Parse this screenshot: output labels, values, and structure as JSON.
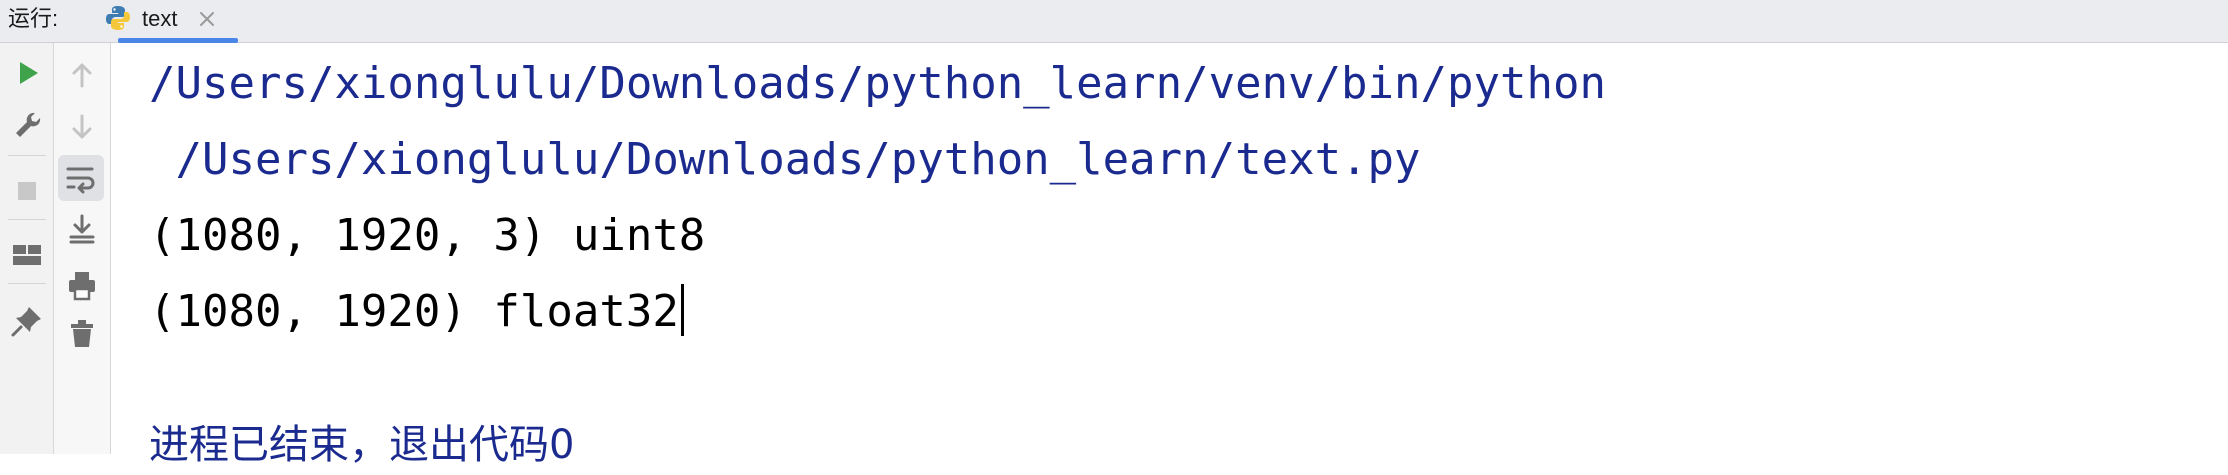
{
  "header": {
    "run_label": "运行:",
    "tab": {
      "title": "text",
      "icon": "python-icon"
    }
  },
  "toolbar": {
    "primary": [
      {
        "name": "run-icon",
        "color": "#3ea34a"
      },
      {
        "name": "wrench-icon"
      },
      {
        "name": "stop-icon"
      },
      {
        "name": "layout-icon"
      },
      {
        "name": "pin-icon"
      }
    ],
    "secondary": [
      {
        "name": "arrow-up-icon"
      },
      {
        "name": "arrow-down-icon"
      },
      {
        "name": "soft-wrap-icon"
      },
      {
        "name": "scroll-to-end-icon"
      },
      {
        "name": "print-icon"
      },
      {
        "name": "trash-icon"
      }
    ]
  },
  "console": {
    "lines": [
      {
        "text": "/Users/xionglulu/Downloads/python_learn/venv/bin/python",
        "kind": "path"
      },
      {
        "text": " /Users/xionglulu/Downloads/python_learn/text.py",
        "kind": "path"
      },
      {
        "text": "(1080, 1920, 3) uint8",
        "kind": "output"
      },
      {
        "text": "(1080, 1920) float32",
        "kind": "output"
      }
    ],
    "exit_message": "进程已结束，退出代码0"
  },
  "colors": {
    "path": "#1a2a8f",
    "output": "#000000",
    "tab_underline": "#4a86e8",
    "run_green": "#3ea34a"
  }
}
